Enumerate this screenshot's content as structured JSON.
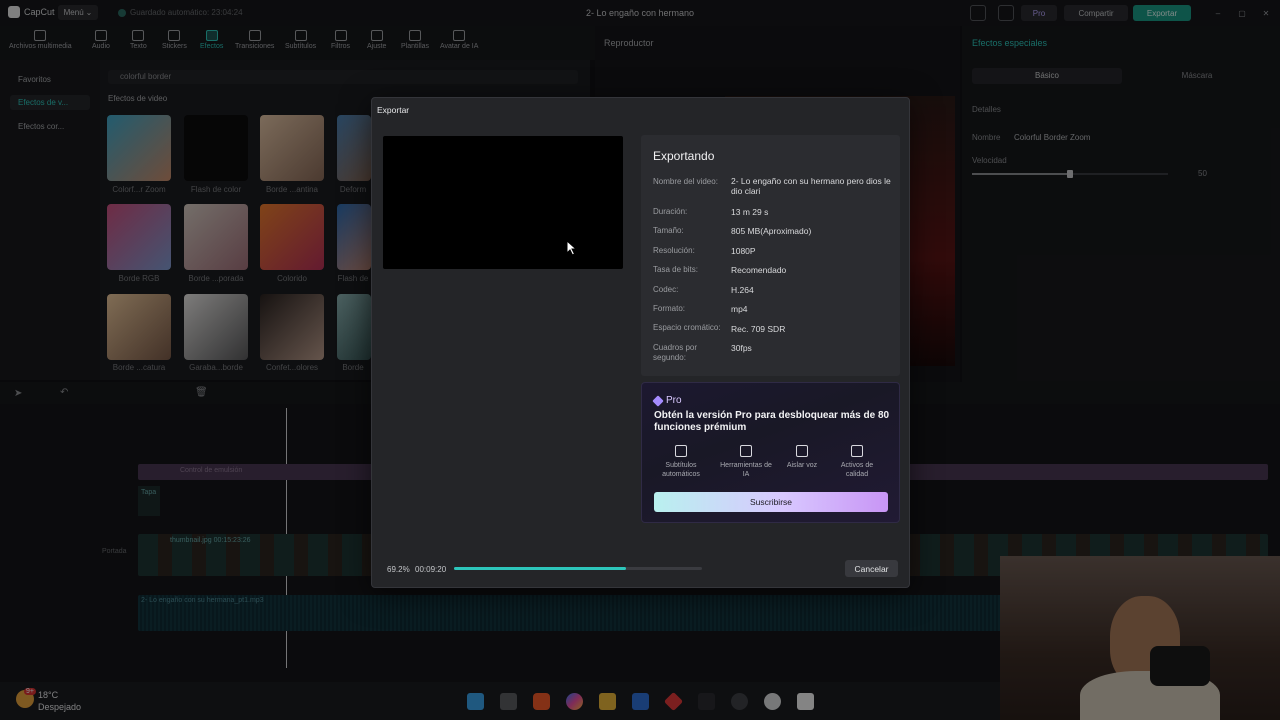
{
  "app": {
    "name": "CapCut",
    "menu_label": "Menú",
    "autosave": "Guardado automático: 23:04:24",
    "project_title": "2- Lo engaño con hermano",
    "pro_label": "Pro",
    "share_label": "Compartir",
    "export_label": "Exportar"
  },
  "toolbar": {
    "items": [
      {
        "label": "Archivos multimedia",
        "icon": "media-icon"
      },
      {
        "label": "Audio",
        "icon": "audio-icon"
      },
      {
        "label": "Texto",
        "icon": "text-icon"
      },
      {
        "label": "Stickers",
        "icon": "sticker-icon"
      },
      {
        "label": "Efectos",
        "icon": "effects-icon"
      },
      {
        "label": "Transiciones",
        "icon": "transitions-icon"
      },
      {
        "label": "Subtítulos",
        "icon": "subtitles-icon"
      },
      {
        "label": "Filtros",
        "icon": "filters-icon"
      },
      {
        "label": "Ajuste",
        "icon": "adjust-icon"
      },
      {
        "label": "Plantillas",
        "icon": "templates-icon"
      },
      {
        "label": "Avatar de IA",
        "icon": "ai-avatar-icon"
      }
    ],
    "active": "Efectos"
  },
  "sidebar": {
    "items": [
      {
        "label": "Favoritos"
      },
      {
        "label": "Efectos de v..."
      },
      {
        "label": "Efectos cor..."
      }
    ]
  },
  "effects": {
    "search_value": "colorful border",
    "section_title": "Efectos de video",
    "items": [
      {
        "label": "Colorf...r Zoom"
      },
      {
        "label": "Flash de color"
      },
      {
        "label": "Borde ...antina"
      },
      {
        "label": "Deform"
      },
      {
        "label": "Borde RGB"
      },
      {
        "label": "Borde ...porada"
      },
      {
        "label": "Colorido"
      },
      {
        "label": "Flash de"
      },
      {
        "label": "Borde ...catura"
      },
      {
        "label": "Garaba...borde"
      },
      {
        "label": "Confet...olores"
      },
      {
        "label": "Borde"
      }
    ]
  },
  "player": {
    "title": "Reproductor"
  },
  "right_panel": {
    "title": "Efectos especiales",
    "tabs": [
      "Básico",
      "Máscara"
    ],
    "details_label": "Detalles",
    "name_label": "Nombre",
    "name_value": "Colorful Border Zoom",
    "speed_label": "Velocidad",
    "speed_value": "50"
  },
  "timeline": {
    "text_clip": "Control de emulsión",
    "cover_label": "Portada",
    "video_clip": "thumbnail.jpg  00:15:23:26",
    "audio_clip": "2- Lo engaño con su hermana_pt1.mp3",
    "tape_label": "Tapa"
  },
  "dialog": {
    "title": "Exportar",
    "status": "Exportando",
    "fields": [
      {
        "key": "Nombre del video:",
        "value": "2- Lo engaño con su hermano pero dios le dio clari"
      },
      {
        "key": "Duración:",
        "value": "13 m 29 s"
      },
      {
        "key": "Tamaño:",
        "value": "805 MB(Aproximado)"
      },
      {
        "key": "Resolución:",
        "value": "1080P"
      },
      {
        "key": "Tasa de bits:",
        "value": "Recomendado"
      },
      {
        "key": "Codec:",
        "value": "H.264"
      },
      {
        "key": "Formato:",
        "value": "mp4"
      },
      {
        "key": "Espacio cromático:",
        "value": "Rec. 709 SDR"
      },
      {
        "key": "Cuadros por segundo:",
        "value": "30fps"
      }
    ],
    "promo": {
      "badge": "Pro",
      "text": "Obtén la versión Pro para desbloquear más de 80 funciones prémium",
      "features": [
        {
          "label": "Subtítulos automáticos",
          "icon": "subtitles-grid-icon"
        },
        {
          "label": "Herramientas de IA",
          "icon": "magic-wand-icon"
        },
        {
          "label": "Aislar voz",
          "icon": "voice-isolate-icon"
        },
        {
          "label": "Activos de calidad",
          "icon": "quality-assets-icon"
        }
      ],
      "button": "Suscribirse"
    },
    "progress_percent": "69.2%",
    "progress_value": 0.692,
    "elapsed": "00:09:20",
    "cancel": "Cancelar"
  },
  "taskbar": {
    "temperature": "18°C",
    "weather": "Despejado",
    "weather_badge": "9+"
  },
  "colors": {
    "accent": "#2dc6bb",
    "export_button": "#1a9a86",
    "promo_gradient_start": "#b9f0ef",
    "promo_gradient_end": "#c895f5"
  }
}
